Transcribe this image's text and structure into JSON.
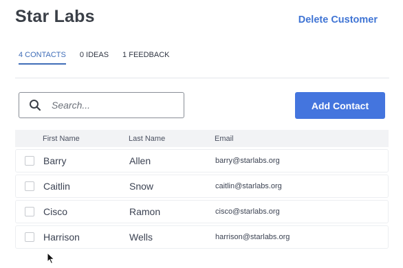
{
  "header": {
    "title": "Star Labs",
    "delete_label": "Delete Customer"
  },
  "tabs": [
    {
      "label": "4 CONTACTS",
      "active": true
    },
    {
      "label": "0 IDEAS",
      "active": false
    },
    {
      "label": "1 FEEDBACK",
      "active": false
    }
  ],
  "search": {
    "placeholder": "Search...",
    "value": ""
  },
  "actions": {
    "add_contact_label": "Add Contact"
  },
  "table": {
    "columns": [
      "First Name",
      "Last Name",
      "Email"
    ],
    "rows": [
      {
        "first": "Barry",
        "last": "Allen",
        "email": "barry@starlabs.org"
      },
      {
        "first": "Caitlin",
        "last": "Snow",
        "email": "caitlin@starlabs.org"
      },
      {
        "first": "Cisco",
        "last": "Ramon",
        "email": "cisco@starlabs.org"
      },
      {
        "first": "Harrison",
        "last": "Wells",
        "email": "harrison@starlabs.org"
      }
    ]
  },
  "colors": {
    "accent": "#4475de",
    "link": "#3f74d4",
    "active_tab": "#3f6db8"
  },
  "icons": {
    "search": "search-icon",
    "cursor": "mouse-cursor-icon"
  }
}
